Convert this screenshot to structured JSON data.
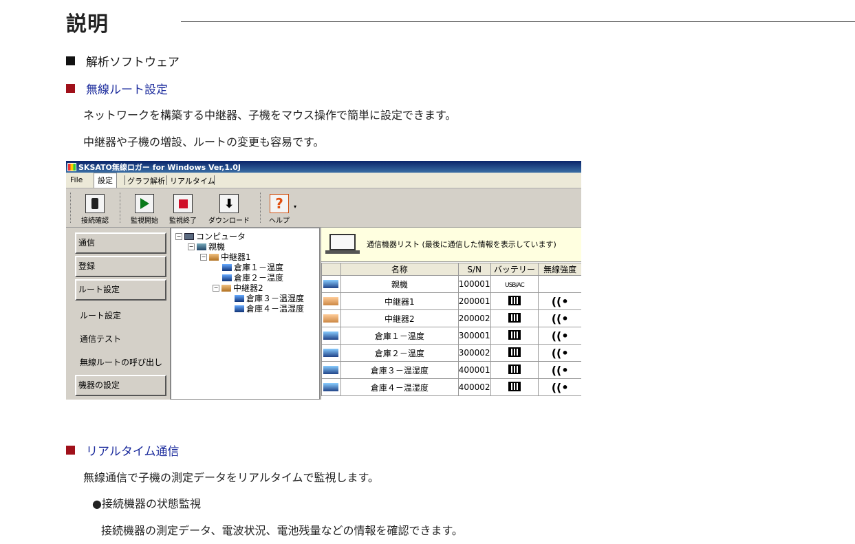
{
  "page": {
    "title": "説明",
    "section1": {
      "heading": "解析ソフトウェア"
    },
    "section2": {
      "heading": "無線ルート設定",
      "para1": "ネットワークを構築する中継器、子機をマウス操作で簡単に設定できます。",
      "para2": "中継器や子機の増設、ルートの変更も容易です。"
    },
    "section3": {
      "heading": "リアルタイム通信",
      "para1": "無線通信で子機の測定データをリアルタイムで監視します。",
      "bullet": "●接続機器の状態監視",
      "para2": "接続機器の測定データ、電波状況、電池残量などの情報を確認できます。"
    }
  },
  "app": {
    "title": "SKSATO無線ロガー for Windows Ver,1.0J",
    "menu": [
      "File",
      "設定",
      "グラフ解析",
      "リアルタイム"
    ],
    "toolbar": [
      "接続確認",
      "監視開始",
      "監視終了",
      "ダウンロード",
      "ヘルプ"
    ],
    "sidebar": {
      "buttons": [
        "通信",
        "登録",
        "ルート設定",
        "機器の設定"
      ],
      "items": [
        "ルート設定",
        "通信テスト",
        "無線ルートの呼び出し"
      ]
    },
    "tree": [
      "コンピュータ",
      "親機",
      "中継器1",
      "倉庫１－温度",
      "倉庫２－温度",
      "中継器2",
      "倉庫３－温湿度",
      "倉庫４－温湿度"
    ],
    "list": {
      "header_text": "通信機器リスト (最後に通信した情報を表示しています)",
      "columns": [
        "名称",
        "S/N",
        "バッテリー",
        "無線強度"
      ],
      "rows": [
        {
          "name": "親機",
          "sn": "100001",
          "battery": "USB/AC",
          "signal": ""
        },
        {
          "name": "中継器1",
          "sn": "200001",
          "battery": "",
          "signal": "((•"
        },
        {
          "name": "中継器2",
          "sn": "200002",
          "battery": "",
          "signal": "((•"
        },
        {
          "name": "倉庫１－温度",
          "sn": "300001",
          "battery": "",
          "signal": "((•"
        },
        {
          "name": "倉庫２－温度",
          "sn": "300002",
          "battery": "",
          "signal": "((•"
        },
        {
          "name": "倉庫３－温湿度",
          "sn": "400001",
          "battery": "",
          "signal": "((•"
        },
        {
          "name": "倉庫４－温湿度",
          "sn": "400002",
          "battery": "",
          "signal": "((•"
        }
      ]
    }
  }
}
